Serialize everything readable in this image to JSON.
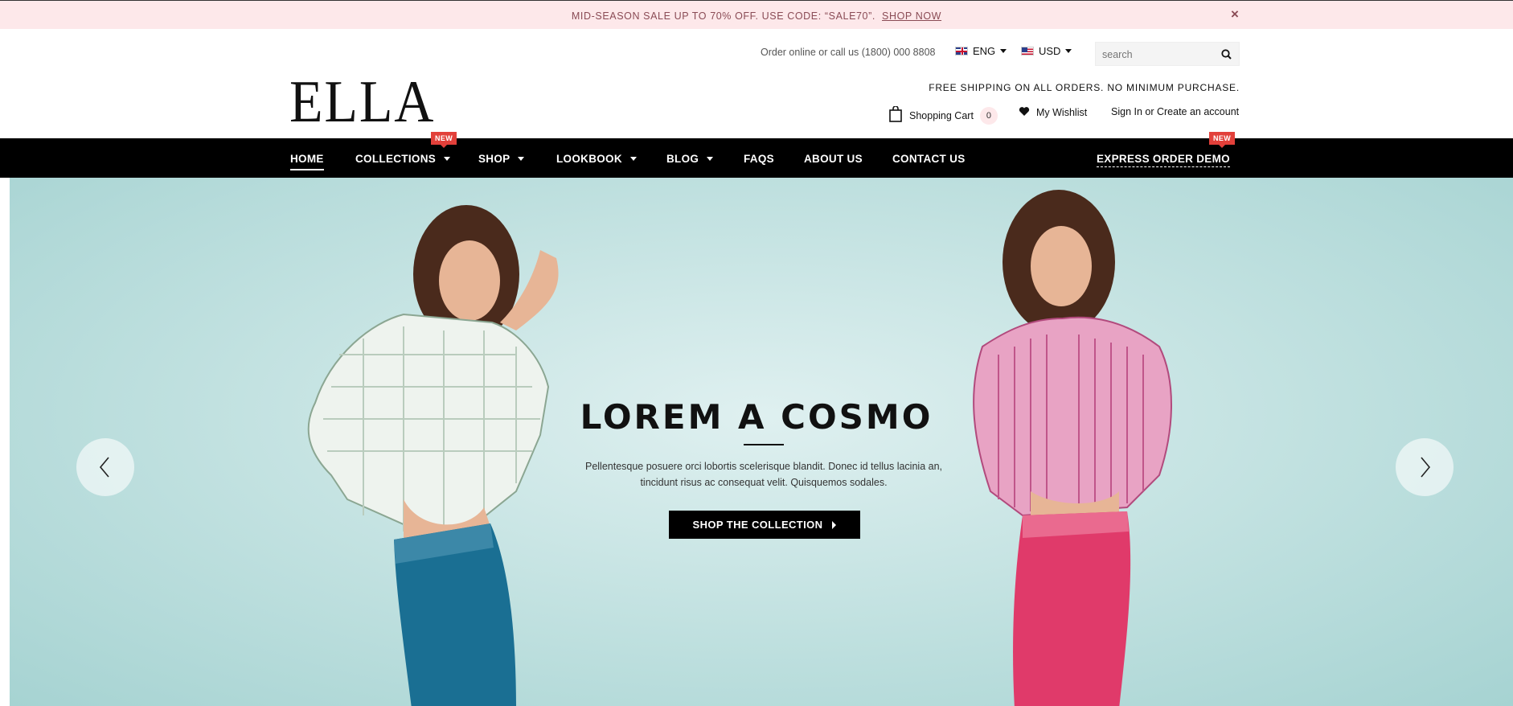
{
  "announcement": {
    "text": "MID-SEASON SALE UP TO 70% OFF. USE CODE: “SALE70”.",
    "link": "SHOP NOW",
    "close": "×"
  },
  "header": {
    "logo": "ELLA",
    "order_text": "Order online or call us (1800) 000 8808",
    "language": "ENG",
    "currency": "USD",
    "search_placeholder": "search",
    "shipping_text": "FREE SHIPPING ON ALL ORDERS. NO MINIMUM PURCHASE.",
    "cart_label": "Shopping Cart",
    "cart_count": "0",
    "wishlist_label": "My Wishlist",
    "account_label": "Sign In or Create an account"
  },
  "nav": {
    "items": [
      {
        "label": "HOME",
        "active": true
      },
      {
        "label": "COLLECTIONS",
        "badge": "NEW"
      },
      {
        "label": "SHOP"
      },
      {
        "label": "LOOKBOOK"
      },
      {
        "label": "BLOG"
      },
      {
        "label": "FAQS"
      },
      {
        "label": "ABOUT US"
      },
      {
        "label": "CONTACT US"
      }
    ],
    "express": {
      "label": "EXPRESS ORDER DEMO",
      "badge": "NEW"
    }
  },
  "hero": {
    "title": "LOREM A COSMO",
    "description": "Pellentesque posuere orci lobortis scelerisque blandit. Donec id tellus lacinia an, tincidunt risus ac consequat velit. Quisquemos sodales.",
    "cta": "SHOP THE COLLECTION"
  },
  "colors": {
    "announcement_bg": "#fde8ea",
    "nav_bg": "#000000",
    "badge": "#e2403a",
    "hero_bg": "#bfe0df",
    "legging_blue": "#1a6f93",
    "legging_pink": "#e03a6a"
  },
  "icons": [
    "close-icon",
    "flag-uk-icon",
    "flag-us-icon",
    "search-icon",
    "shopping-bag-icon",
    "heart-icon",
    "chevron-left-icon",
    "chevron-right-icon"
  ]
}
